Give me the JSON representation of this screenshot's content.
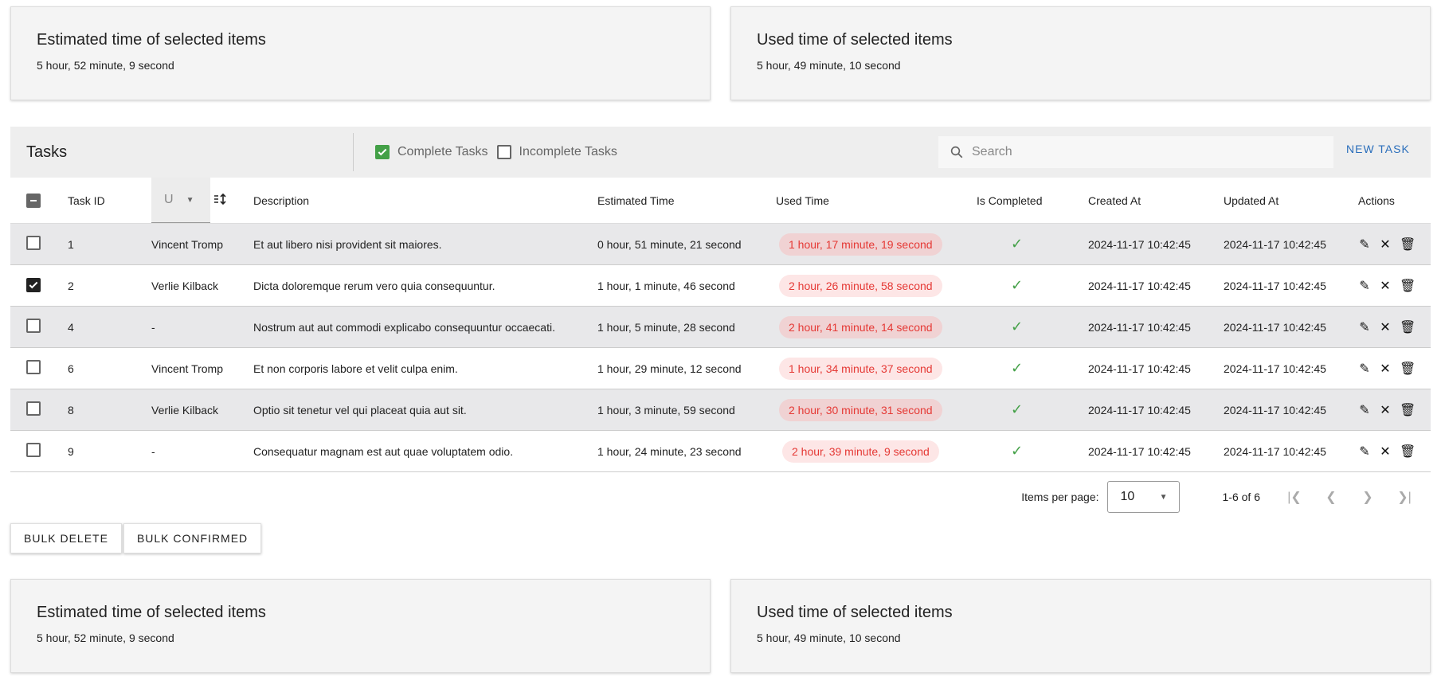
{
  "summary_top": {
    "estimated_title": "Estimated time of selected items",
    "estimated_value": "5 hour, 52 minute, 9 second",
    "used_title": "Used time of selected items",
    "used_value": "5 hour, 49 minute, 10 second"
  },
  "summary_bottom": {
    "estimated_title": "Estimated time of selected items",
    "estimated_value": "5 hour, 52 minute, 9 second",
    "used_title": "Used time of selected items",
    "used_value": "5 hour, 49 minute, 10 second"
  },
  "toolbar": {
    "title": "Tasks",
    "filter_complete": "Complete Tasks",
    "filter_incomplete": "Incomplete Tasks",
    "search_placeholder": "Search",
    "new_task": "NEW TASK"
  },
  "table": {
    "headers": {
      "task_id": "Task ID",
      "user": "U",
      "description": "Description",
      "estimated": "Estimated Time",
      "used": "Used Time",
      "completed": "Is Completed",
      "created": "Created At",
      "updated": "Updated At",
      "actions": "Actions"
    },
    "rows": [
      {
        "id": "1",
        "user": "Vincent Tromp",
        "description": "Et aut libero nisi provident sit maiores.",
        "estimated": "0 hour, 51 minute, 21 second",
        "used": "1 hour, 17 minute, 19 second",
        "created": "2024-11-17 10:42:45",
        "updated": "2024-11-17 10:42:45",
        "selected": false
      },
      {
        "id": "2",
        "user": "Verlie Kilback",
        "description": "Dicta doloremque rerum vero quia consequuntur.",
        "estimated": "1 hour, 1 minute, 46 second",
        "used": "2 hour, 26 minute, 58 second",
        "created": "2024-11-17 10:42:45",
        "updated": "2024-11-17 10:42:45",
        "selected": true
      },
      {
        "id": "4",
        "user": "-",
        "description": "Nostrum aut aut commodi explicabo consequuntur occaecati.",
        "estimated": "1 hour, 5 minute, 28 second",
        "used": "2 hour, 41 minute, 14 second",
        "created": "2024-11-17 10:42:45",
        "updated": "2024-11-17 10:42:45",
        "selected": false
      },
      {
        "id": "6",
        "user": "Vincent Tromp",
        "description": "Et non corporis labore et velit culpa enim.",
        "estimated": "1 hour, 29 minute, 12 second",
        "used": "1 hour, 34 minute, 37 second",
        "created": "2024-11-17 10:42:45",
        "updated": "2024-11-17 10:42:45",
        "selected": false
      },
      {
        "id": "8",
        "user": "Verlie Kilback",
        "description": "Optio sit tenetur vel qui placeat quia aut sit.",
        "estimated": "1 hour, 3 minute, 59 second",
        "used": "2 hour, 30 minute, 31 second",
        "created": "2024-11-17 10:42:45",
        "updated": "2024-11-17 10:42:45",
        "selected": false
      },
      {
        "id": "9",
        "user": "-",
        "description": "Consequatur magnam est aut quae voluptatem odio.",
        "estimated": "1 hour, 24 minute, 23 second",
        "used": "2 hour, 39 minute, 9 second",
        "created": "2024-11-17 10:42:45",
        "updated": "2024-11-17 10:42:45",
        "selected": false
      }
    ]
  },
  "pager": {
    "items_per_page_label": "Items per page:",
    "items_per_page_value": "10",
    "range": "1-6 of 6"
  },
  "bulk": {
    "delete": "BULK DELETE",
    "confirmed": "BULK CONFIRMED"
  },
  "colors": {
    "accent_blue": "#2a6ebb",
    "check_green": "#43a047",
    "used_red": "#e53935"
  }
}
